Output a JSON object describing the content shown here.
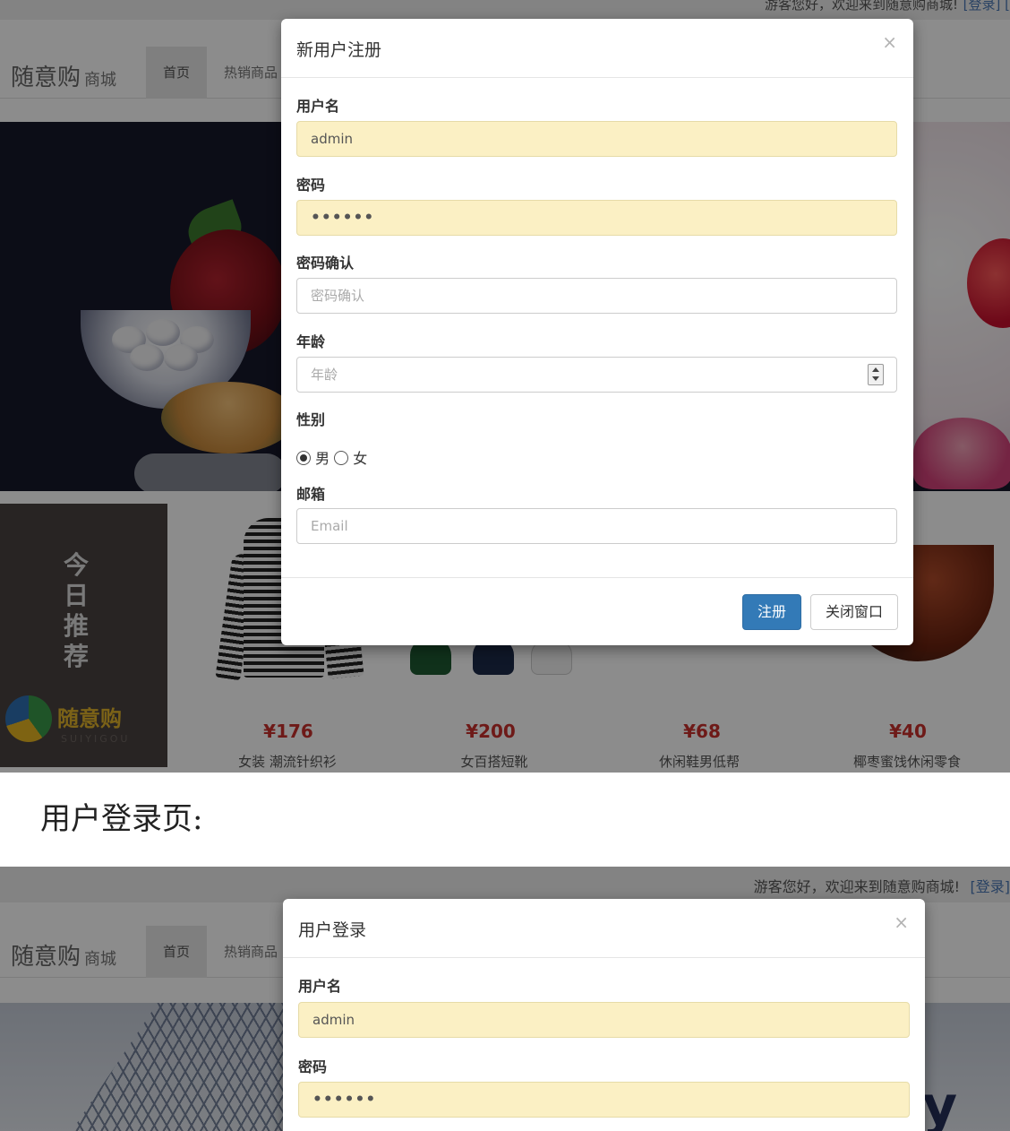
{
  "register_shot": {
    "topbar": {
      "welcome": "游客您好，欢迎来到随意购商城!",
      "login_link": "[登录] ["
    },
    "brand": {
      "name": "随意购",
      "suffix": "商城"
    },
    "nav": {
      "home": "首页",
      "hot": "热销商品"
    },
    "today": {
      "text": "今日推荐",
      "logo_text": "随意购",
      "logo_sub": "SUIYIGOU"
    },
    "products": [
      {
        "price": "¥176",
        "name": "女装 潮流针织衫"
      },
      {
        "price": "¥200",
        "name": "女百搭短靴"
      },
      {
        "price": "¥68",
        "name": "休闲鞋男低帮"
      },
      {
        "price": "¥40",
        "name": "椰枣蜜饯休闲零食"
      }
    ],
    "modal": {
      "title": "新用户注册",
      "close": "×",
      "username_label": "用户名",
      "username_value": "admin",
      "password_label": "密码",
      "password_value": "••••••",
      "confirm_label": "密码确认",
      "confirm_placeholder": "密码确认",
      "age_label": "年龄",
      "age_placeholder": "年龄",
      "gender_label": "性别",
      "gender_male": "男",
      "gender_female": "女",
      "gender_selected": "男",
      "email_label": "邮箱",
      "email_placeholder": "Email",
      "submit_button": "注册",
      "close_button": "关闭窗口"
    }
  },
  "caption": "用户登录页:",
  "login_shot": {
    "topbar": {
      "welcome": "游客您好，欢迎来到随意购商城!",
      "login_link": "[登录]"
    },
    "brand": {
      "name": "随意购",
      "suffix": "商城"
    },
    "nav": {
      "home": "首页",
      "hot": "热销商品"
    },
    "modal": {
      "title": "用户登录",
      "close": "×",
      "username_label": "用户名",
      "username_value": "admin",
      "password_label": "密码",
      "password_value": "••••••"
    }
  },
  "colors": {
    "primary": "#337ab7",
    "autofill": "#fbf0c4",
    "price": "#c9302c",
    "overlay": "rgba(0,0,0,0.45)"
  }
}
